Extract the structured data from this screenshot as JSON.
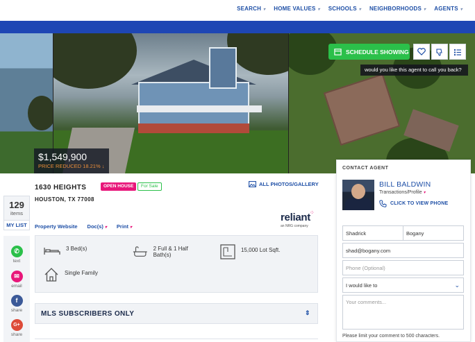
{
  "nav": {
    "items": [
      {
        "label": "SEARCH"
      },
      {
        "label": "HOME VALUES"
      },
      {
        "label": "SCHOOLS"
      },
      {
        "label": "NEIGHBORHOODS"
      },
      {
        "label": "AGENTS"
      }
    ]
  },
  "gallery": {
    "price": "$1,549,900",
    "price_reduced": "PRICE REDUCED 18.21% ↓",
    "schedule_label": "SCHEDULE SHOWING",
    "callback_prompt": "would you like this agent to call you back?",
    "icons": [
      "calendar-icon",
      "heart-icon",
      "thumbs-down-icon",
      "list-icon"
    ]
  },
  "listing": {
    "address_line1": "1630 HEIGHTS",
    "address_line2": "HOUSTON, TX 77008",
    "badge_open": "OPEN HOUSE",
    "badge_status": "For Sale",
    "gallery_link": "ALL PHOTOS/GALLERY",
    "links": {
      "website": "Property Website",
      "docs": "Doc(s)",
      "print": "Print"
    },
    "features": {
      "beds": "3 Bed(s)",
      "baths": "2 Full & 1 Half Bath(s)",
      "lot": "15,000 Lot Sqft.",
      "type": "Single Family"
    },
    "mls_heading": "MLS SUBSCRIBERS ONLY"
  },
  "sponsor": {
    "name": "reliant",
    "tagline": "an NRG company"
  },
  "sidebar": {
    "count": "129",
    "count_label": "items",
    "my_list": "MY LIST",
    "share": [
      {
        "label": "text",
        "color": "#2bc04a"
      },
      {
        "label": "email",
        "color": "#e8177a"
      },
      {
        "label": "share",
        "color": "#3b5998"
      },
      {
        "label": "share",
        "color": "#dd4b39"
      }
    ]
  },
  "contact": {
    "title": "CONTACT AGENT",
    "agent_name": "BILL BALDWIN",
    "agent_role": "Transactions/Profile",
    "phone_link": "CLICK TO VIEW PHONE",
    "first_name": "Shadrick",
    "last_name": "Bogany",
    "email": "shad@bogany.com",
    "phone_placeholder": "Phone (Optional)",
    "select_value": "I would like to",
    "comments_placeholder": "Your comments...",
    "limit_note": "Please limit your comment to 500 characters."
  },
  "colors": {
    "brand_blue": "#1e4fa6",
    "banner_blue": "#1e46b4",
    "accent_pink": "#e8177a",
    "accent_green": "#2bc04a"
  }
}
